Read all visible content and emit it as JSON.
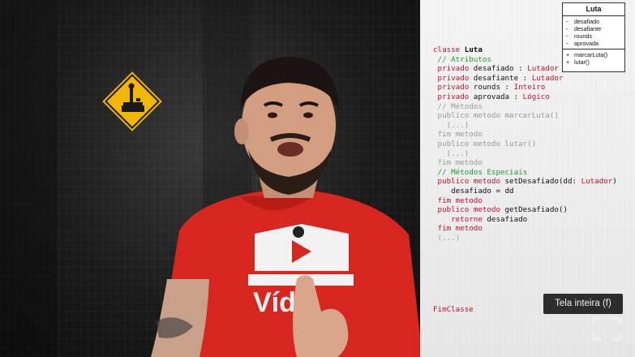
{
  "uml": {
    "title": "Luta",
    "attributes": [
      {
        "sym": "-",
        "name": "desafiado"
      },
      {
        "sym": "-",
        "name": "desafiante"
      },
      {
        "sym": "-",
        "name": "rounds"
      },
      {
        "sym": "-",
        "name": "aprovada"
      }
    ],
    "methods": [
      {
        "sym": "+",
        "name": "marcarLuta()"
      },
      {
        "sym": "+",
        "name": "lutar()"
      }
    ]
  },
  "code": {
    "lines": [
      [
        {
          "t": "classe ",
          "c": "c-kw"
        },
        {
          "t": "Luta",
          "c": "c-bold"
        }
      ],
      [
        {
          "t": " // Atributos",
          "c": "c-comment"
        }
      ],
      [
        {
          "t": " privado ",
          "c": "c-kw"
        },
        {
          "t": "desafiado : ",
          "c": "c-black"
        },
        {
          "t": "Lutador",
          "c": "c-type"
        }
      ],
      [
        {
          "t": " privado ",
          "c": "c-kw"
        },
        {
          "t": "desafiante : ",
          "c": "c-black"
        },
        {
          "t": "Lutador",
          "c": "c-type"
        }
      ],
      [
        {
          "t": " privado ",
          "c": "c-kw"
        },
        {
          "t": "rounds : ",
          "c": "c-black"
        },
        {
          "t": "Inteiro",
          "c": "c-type"
        }
      ],
      [
        {
          "t": " privado ",
          "c": "c-kw"
        },
        {
          "t": "aprovada : ",
          "c": "c-black"
        },
        {
          "t": "Lógico",
          "c": "c-type"
        }
      ],
      [
        {
          "t": " // Métodos",
          "c": "c-faded"
        }
      ],
      [
        {
          "t": " publico metodo marcarLuta()",
          "c": "c-faded"
        }
      ],
      [
        {
          "t": "   (...)",
          "c": "c-faded"
        }
      ],
      [
        {
          "t": " fim metodo",
          "c": "c-faded"
        }
      ],
      [
        {
          "t": " publico metodo lutar()",
          "c": "c-faded"
        }
      ],
      [
        {
          "t": "   (...)",
          "c": "c-faded"
        }
      ],
      [
        {
          "t": " fim metodo",
          "c": "c-faded"
        }
      ],
      [
        {
          "t": " // Métodos Especiais",
          "c": "c-comment"
        }
      ],
      [
        {
          "t": " publico metodo ",
          "c": "c-kw"
        },
        {
          "t": "setDesafiado(dd: ",
          "c": "c-black"
        },
        {
          "t": "Lutador",
          "c": "c-type"
        },
        {
          "t": ")",
          "c": "c-black"
        }
      ],
      [
        {
          "t": "    desafiado = dd",
          "c": "c-black"
        }
      ],
      [
        {
          "t": " fim metodo",
          "c": "c-kw"
        }
      ],
      [
        {
          "t": " publico metodo ",
          "c": "c-kw"
        },
        {
          "t": "getDesafiado()",
          "c": "c-black"
        }
      ],
      [
        {
          "t": "    retorne ",
          "c": "c-kw"
        },
        {
          "t": "desafiado",
          "c": "c-black"
        }
      ],
      [
        {
          "t": " fim metodo",
          "c": "c-kw"
        }
      ],
      [
        {
          "t": " (...)",
          "c": "c-faded"
        }
      ]
    ],
    "end_label": "FimClasse"
  },
  "tooltip": {
    "text": "Tela inteira (f)"
  },
  "shirt": {
    "text": "Víd"
  },
  "colors": {
    "keyword": "#c3102a",
    "comment": "#1f9a2c",
    "shirt": "#d7261f",
    "logo": "#f2b705"
  }
}
